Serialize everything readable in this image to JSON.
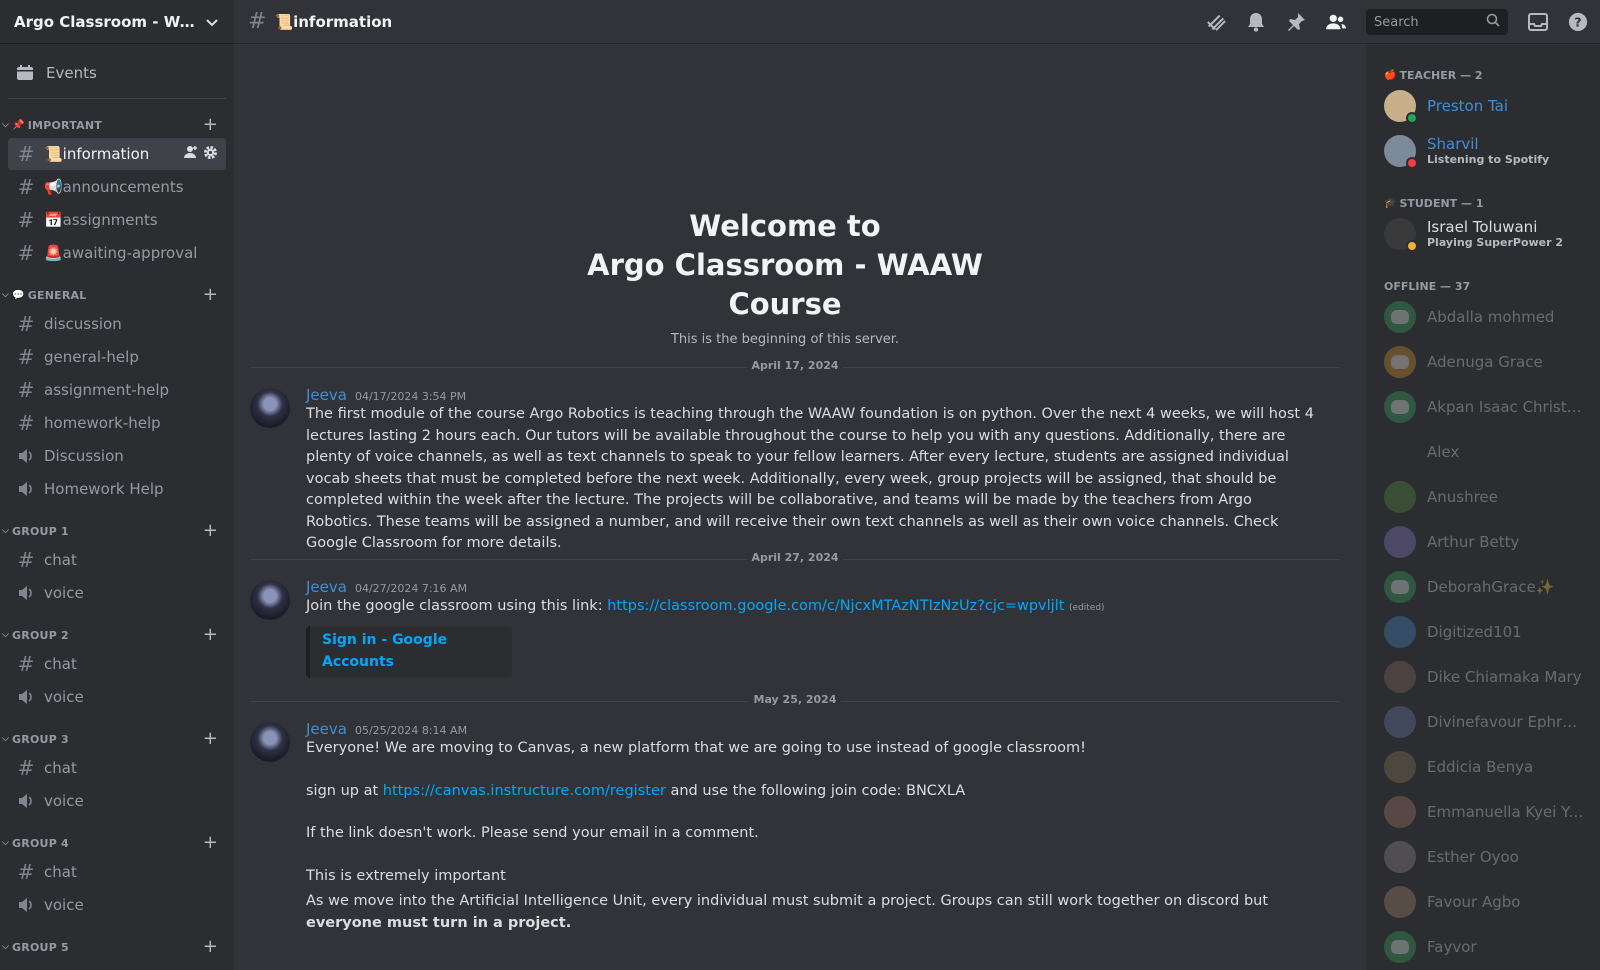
{
  "server": {
    "name": "Argo Classroom - WAAW Course"
  },
  "sidebar": {
    "events_label": "Events",
    "categories": [
      {
        "label": "IMPORTANT",
        "emoji": "📌",
        "channels": [
          {
            "label": "📜information",
            "type": "text",
            "active": true
          },
          {
            "label": "📢announcements",
            "type": "text"
          },
          {
            "label": "📅assignments",
            "type": "text"
          },
          {
            "label": "🚨awaiting-approval",
            "type": "text"
          }
        ]
      },
      {
        "label": "GENERAL",
        "emoji": "💬",
        "channels": [
          {
            "label": "discussion",
            "type": "text"
          },
          {
            "label": "general-help",
            "type": "text"
          },
          {
            "label": "assignment-help",
            "type": "text"
          },
          {
            "label": "homework-help",
            "type": "text"
          },
          {
            "label": "Discussion",
            "type": "voice"
          },
          {
            "label": "Homework Help",
            "type": "voice"
          }
        ]
      },
      {
        "label": "GROUP 1",
        "emoji": "",
        "channels": [
          {
            "label": "chat",
            "type": "text"
          },
          {
            "label": "voice",
            "type": "voice"
          }
        ]
      },
      {
        "label": "GROUP 2",
        "emoji": "",
        "channels": [
          {
            "label": "chat",
            "type": "text"
          },
          {
            "label": "voice",
            "type": "voice"
          }
        ]
      },
      {
        "label": "GROUP 3",
        "emoji": "",
        "channels": [
          {
            "label": "chat",
            "type": "text"
          },
          {
            "label": "voice",
            "type": "voice"
          }
        ]
      },
      {
        "label": "GROUP 4",
        "emoji": "",
        "channels": [
          {
            "label": "chat",
            "type": "text"
          },
          {
            "label": "voice",
            "type": "voice"
          }
        ]
      },
      {
        "label": "GROUP 5",
        "emoji": "",
        "channels": []
      }
    ]
  },
  "topbar": {
    "channel_title": "📜information",
    "search_placeholder": "Search",
    "icons": [
      "threads-icon",
      "bell-icon",
      "pin-icon",
      "members-icon",
      "inbox-icon",
      "help-icon"
    ]
  },
  "welcome": {
    "line1": "Welcome to",
    "line2": "Argo Classroom - WAAW",
    "line3": "Course",
    "subtitle": "This is the beginning of this server."
  },
  "dividers": [
    "April 17, 2024",
    "April 27, 2024",
    "May 25, 2024"
  ],
  "messages": [
    {
      "author": "Jeeva",
      "timestamp": "04/17/2024 3:54 PM",
      "text": "The first module of the course Argo Robotics is teaching through the WAAW foundation is on python. Over the next 4 weeks, we will host 4 lectures lasting 2 hours each. Our tutors will be available throughout the course to help you with any questions. Additionally, there are plenty of voice channels, as well as text channels to speak to your fellow learners. After every lecture, students are assigned individual vocab sheets that must be completed before the next week. Additionally, every week, group projects will be assigned, that should be completed within the week after the lecture. The projects will be collaborative, and teams will be made by the teachers from Argo Robotics. These teams will be assigned a number, and will receive their own text channels as well as their own voice channels. Check Google Classroom for more details."
    },
    {
      "author": "Jeeva",
      "timestamp": "04/27/2024 7:16 AM",
      "text": "Join the google classroom using this link: ",
      "link": "https://classroom.google.com/c/NjcxMTAzNTIzNzUz?cjc=wpvljlt",
      "edited": "(edited)",
      "embed_title": "Sign in - Google Accounts"
    },
    {
      "author": "Jeeva",
      "timestamp": "05/25/2024 8:14 AM",
      "line1": "Everyone! We are moving to Canvas, a new platform that we are going to use instead of google classroom!",
      "line2_pre": "sign up at ",
      "line2_link": "https://canvas.instructure.com/register",
      "line2_post": " and use the following join code: BNCXLA",
      "line3": "If the link doesn't work. Please send your email in a comment.",
      "line4": "This is extremely important",
      "line5_pre": "As we move into the Artificial Intelligence Unit, every individual must submit a project. Groups can still work together on discord but ",
      "line5_bold": "everyone must turn in a project."
    }
  ],
  "members": {
    "teacher_header": "TEACHER — 2",
    "teacher_emoji": "🍎",
    "teachers": [
      {
        "name": "Preston Tai",
        "activity": "",
        "status": "online",
        "color": "#c7b08a"
      },
      {
        "name": "Sharvil",
        "activity": "Listening to Spotify",
        "status": "dnd",
        "color": "#7d8a99"
      }
    ],
    "student_header": "STUDENT — 1",
    "student_emoji": "🎓",
    "students": [
      {
        "name": "Israel Toluwani",
        "activity": "Playing SuperPower 2",
        "status": "idle",
        "color": "#3a3a3a"
      }
    ],
    "offline_header": "OFFLINE — 37",
    "offline": [
      {
        "name": "Abdalla mohmed",
        "color": "#3ba55c",
        "default": true
      },
      {
        "name": "Adenuga Grace",
        "color": "#d9922e",
        "default": true
      },
      {
        "name": "Akpan Isaac Christop...",
        "color": "#3ba55c",
        "default": true
      },
      {
        "name": "Alex",
        "color": "#2b2d31",
        "default": false
      },
      {
        "name": "Anushree",
        "color": "#5a8a3a",
        "default": false
      },
      {
        "name": "Arthur Betty",
        "color": "#8a7ac9",
        "default": false
      },
      {
        "name": "DeborahGrace✨",
        "color": "#3ba55c",
        "default": true
      },
      {
        "name": "Digitized101",
        "color": "#4a8ac9",
        "default": false
      },
      {
        "name": "Dike Chiamaka Mary",
        "color": "#8a6a5a",
        "default": false
      },
      {
        "name": "Divinefavour Ephraim",
        "color": "#6a7aa9",
        "default": false
      },
      {
        "name": "Eddicia Benya",
        "color": "#8a7a5a",
        "default": false
      },
      {
        "name": "Emmanuella Kyei Yeb...",
        "color": "#a97a6a",
        "default": false
      },
      {
        "name": "Esther Oyoo",
        "color": "#9a8a8a",
        "default": false
      },
      {
        "name": "Favour Agbo",
        "color": "#a98a6a",
        "default": false
      },
      {
        "name": "Fayvor",
        "color": "#3ba55c",
        "default": true
      }
    ]
  },
  "colors": {
    "online": "#23a55a",
    "dnd": "#f23f43",
    "idle": "#f0b232",
    "link": "#00a8fc",
    "teacher": "#3f8fd6"
  }
}
